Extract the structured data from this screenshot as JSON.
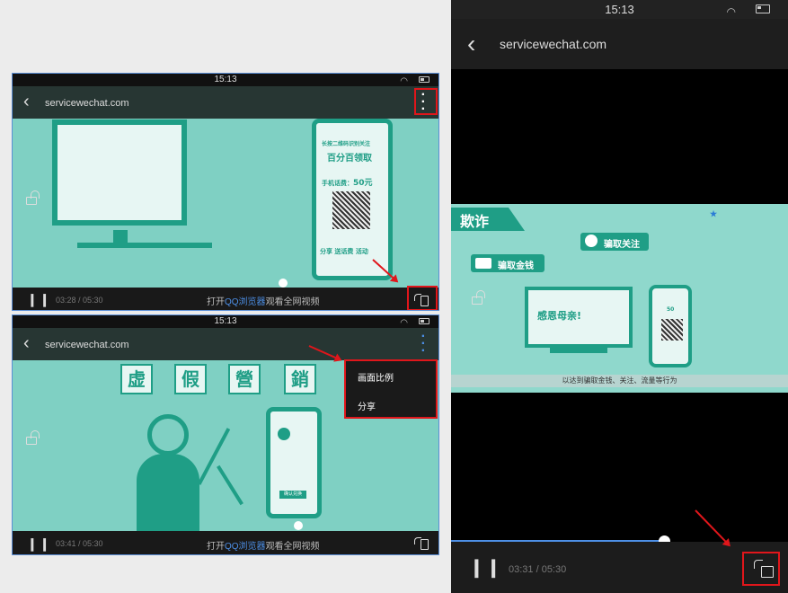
{
  "status": {
    "time": "15:13"
  },
  "browser": {
    "url": "servicewechat.com"
  },
  "panel1": {
    "time": "03:28 / 05:30",
    "promo_prefix": "打开",
    "promo_link": "QQ浏览器",
    "promo_suffix": "观看全网视频",
    "video": {
      "line1": "长按二维码识别关注",
      "line2": "百分百领取",
      "line3": "手机话费：",
      "line3_value": "50元",
      "buttons": "分享  送话费  活动"
    }
  },
  "panel2": {
    "time": "03:41 / 05:30",
    "promo_prefix": "打开",
    "promo_link": "QQ浏览器",
    "promo_suffix": "观看全网视频",
    "menu": [
      "画面比例",
      "分享"
    ],
    "video": {
      "chars": [
        "虚",
        "假",
        "營",
        "銷"
      ],
      "phone_button": "确认兑换"
    }
  },
  "panel3": {
    "time": "03:31 / 05:30",
    "video": {
      "banner": "欺诈",
      "tag1": "骗取金钱",
      "tag2": "骗取关注",
      "screen_text": "感恩母亲!",
      "phone_value": "50",
      "caption": "以达到骗取金钱、关注、流量等行为"
    }
  },
  "colors": {
    "accent": "#e0161b",
    "link": "#4d8fe6",
    "video_green": "#1f9e86"
  },
  "icons": [
    "back-icon",
    "more-icon",
    "wifi-icon",
    "battery-icon",
    "rotate-icon",
    "lock-icon",
    "pause-icon"
  ]
}
